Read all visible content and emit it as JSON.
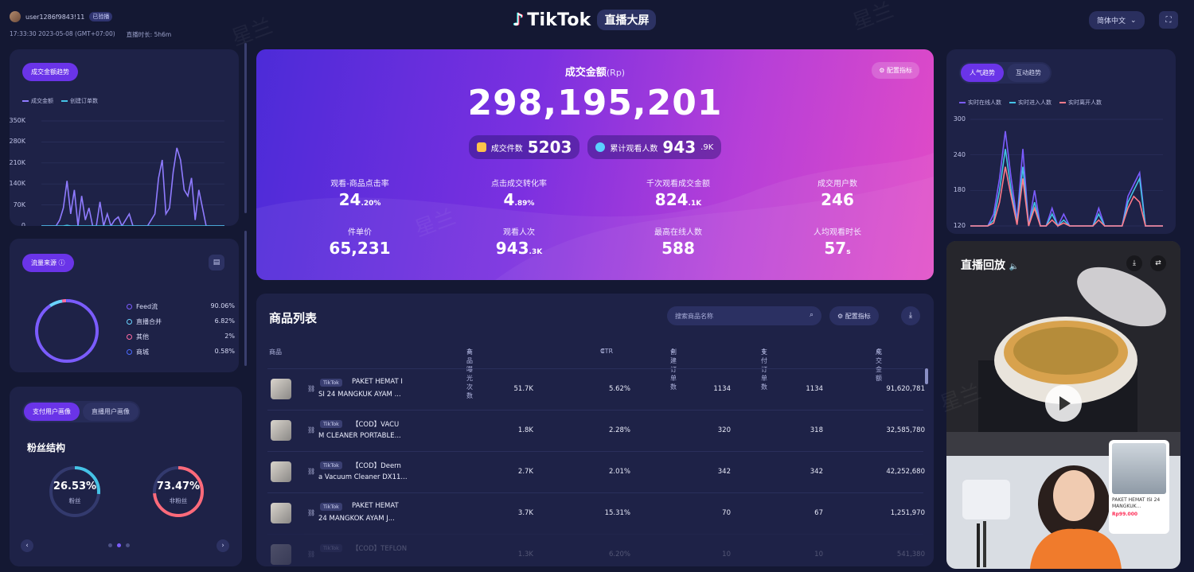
{
  "header": {
    "username": "user1286f9843!11",
    "user_badge": "已验播",
    "time_info": "17:33:30 2023-05-08 (GMT+07:00)",
    "duration_label": "直播时长: 5h6m",
    "brand": "TikTok",
    "brand_tag": "直播大屏",
    "language": "简体中文",
    "fullscreen_icon": "fullscreen-icon"
  },
  "gmv_trend": {
    "tab": "成交金额趋势",
    "legend": [
      "成交金额",
      "创建订单数"
    ],
    "legend_colors": [
      "#8f7bff",
      "#45c3e6"
    ],
    "y_ticks": [
      "350K",
      "280K",
      "210K",
      "140K",
      "70K",
      "0"
    ]
  },
  "traffic": {
    "tab": "流量来源",
    "items": [
      {
        "name": "Feed流",
        "pct": "90.06%",
        "color": "#7b5cff"
      },
      {
        "name": "直播合并",
        "pct": "6.82%",
        "color": "#6ad4ff"
      },
      {
        "name": "其他",
        "pct": "2%",
        "color": "#ff6aa2"
      },
      {
        "name": "商城",
        "pct": "0.58%",
        "color": "#4a6bff"
      }
    ]
  },
  "fans": {
    "tabs": [
      "支付用户画像",
      "直播用户画像"
    ],
    "title": "粉丝结构",
    "fan_pct": "26.53%",
    "fan_label": "粉丝",
    "nonfan_pct": "73.47%",
    "nonfan_label": "非粉丝"
  },
  "hero": {
    "title": "成交金额",
    "title_unit": "(Rp)",
    "amount": "298,195,201",
    "config_btn": "配置指标",
    "chips": [
      {
        "label": "成交件数",
        "value": "5203",
        "unit": ""
      },
      {
        "label": "累计观看人数",
        "value": "943",
        "unit": ".9K"
      }
    ],
    "metrics": [
      {
        "label": "观看-商品点击率",
        "value": "24",
        "unit": ".20%"
      },
      {
        "label": "点击成交转化率",
        "value": "4",
        "unit": ".89%"
      },
      {
        "label": "千次观看成交金额",
        "value": "824",
        "unit": ".1K"
      },
      {
        "label": "成交用户数",
        "value": "246",
        "unit": ""
      },
      {
        "label": "件单价",
        "value": "65,231",
        "unit": ""
      },
      {
        "label": "观看人次",
        "value": "943",
        "unit": ".3K"
      },
      {
        "label": "最高在线人数",
        "value": "588",
        "unit": ""
      },
      {
        "label": "人均观看时长",
        "value": "57",
        "unit": "s"
      }
    ]
  },
  "products": {
    "title": "商品列表",
    "search_placeholder": "搜索商品名称",
    "config_btn": "配置指标",
    "columns": [
      "商品",
      "商品曝光次数",
      "CTR",
      "创建订单数",
      "支付订单数",
      "成交金额"
    ],
    "rows": [
      {
        "tag": "TikTok",
        "name1": "PAKET HEMAT I",
        "name2": "SI 24 MANGKUK AYAM ...",
        "impressions": "51.7K",
        "ctr": "5.62%",
        "created": "1134",
        "paid": "1134",
        "gmv": "91,620,781"
      },
      {
        "tag": "TikTok",
        "name1": "【COD】VACU",
        "name2": "M CLEANER PORTABLE...",
        "impressions": "1.8K",
        "ctr": "2.28%",
        "created": "320",
        "paid": "318",
        "gmv": "32,585,780"
      },
      {
        "tag": "TikTok",
        "name1": "【COD】Deern",
        "name2": "a Vacuum Cleaner DX11...",
        "impressions": "2.7K",
        "ctr": "2.01%",
        "created": "342",
        "paid": "342",
        "gmv": "42,252,680"
      },
      {
        "tag": "TikTok",
        "name1": "PAKET HEMAT",
        "name2": "24 MANGKOK AYAM J...",
        "impressions": "3.7K",
        "ctr": "15.31%",
        "created": "70",
        "paid": "67",
        "gmv": "1,251,970"
      },
      {
        "tag": "TikTok",
        "name1": "【COD】TEFLON",
        "name2": "",
        "impressions": "1.3K",
        "ctr": "6.20%",
        "created": "10",
        "paid": "10",
        "gmv": "541,380"
      }
    ]
  },
  "popularity": {
    "tabs": [
      "人气趋势",
      "互动趋势"
    ],
    "legend": [
      "实时在线人数",
      "实时进入人数",
      "实时离开人数"
    ],
    "legend_colors": [
      "#7b5cff",
      "#45c3e6",
      "#ff7a8a"
    ],
    "y_ticks": [
      "300",
      "240",
      "180",
      "120"
    ]
  },
  "replay": {
    "title": "直播回放",
    "product_name": "PAKET HEMAT ISI 24 MANGKUK...",
    "product_price": "Rp99.000"
  },
  "chart_data": [
    {
      "type": "line",
      "title": "成交金额趋势",
      "ylim": [
        0,
        350000
      ],
      "series": [
        {
          "name": "成交金额",
          "values": [
            0,
            0,
            0,
            0,
            0,
            20000,
            60000,
            150000,
            40000,
            120000,
            0,
            100000,
            20000,
            60000,
            0,
            0,
            80000,
            0,
            40000,
            0,
            20000,
            30000,
            0,
            20000,
            40000,
            0,
            0,
            0,
            0,
            0,
            20000,
            40000,
            160000,
            220000,
            40000,
            60000,
            180000,
            260000,
            220000,
            120000,
            100000,
            160000,
            20000,
            120000,
            60000,
            0,
            0,
            0,
            0,
            0,
            0
          ]
        },
        {
          "name": "创建订单数",
          "values": [
            0,
            0,
            0,
            0,
            0,
            0,
            0,
            2000,
            0,
            0,
            0,
            0,
            0,
            0,
            0,
            0,
            0,
            0,
            0,
            0,
            0,
            0,
            0,
            0,
            0,
            0,
            0,
            0,
            0,
            0,
            0,
            0,
            0,
            0,
            0,
            0,
            0,
            0,
            0,
            0,
            0,
            0,
            0,
            0,
            0,
            0,
            0,
            0,
            0,
            0,
            0
          ]
        }
      ]
    },
    {
      "type": "line",
      "title": "人气趋势",
      "ylim": [
        120,
        300
      ],
      "series": [
        {
          "name": "实时在线人数",
          "values": [
            120,
            120,
            120,
            120,
            140,
            200,
            280,
            200,
            130,
            250,
            120,
            180,
            120,
            120,
            150,
            120,
            140,
            120,
            120,
            120,
            120,
            120,
            150,
            120,
            120,
            120,
            120,
            170,
            190,
            210,
            120,
            120,
            120,
            120
          ]
        },
        {
          "name": "实时进入人数",
          "values": [
            120,
            120,
            120,
            120,
            130,
            180,
            250,
            180,
            125,
            220,
            120,
            160,
            120,
            120,
            140,
            120,
            130,
            120,
            120,
            120,
            120,
            120,
            140,
            120,
            120,
            120,
            120,
            160,
            180,
            200,
            120,
            120,
            120,
            120
          ]
        },
        {
          "name": "实时离开人数",
          "values": [
            120,
            120,
            120,
            120,
            125,
            160,
            220,
            170,
            122,
            200,
            120,
            150,
            120,
            120,
            130,
            120,
            125,
            120,
            120,
            120,
            120,
            120,
            130,
            120,
            120,
            120,
            120,
            150,
            170,
            160,
            120,
            120,
            120,
            120
          ]
        }
      ]
    },
    {
      "type": "pie",
      "title": "流量来源",
      "categories": [
        "Feed流",
        "直播合并",
        "其他",
        "商城"
      ],
      "values": [
        90.06,
        6.82,
        2,
        0.58
      ]
    }
  ]
}
